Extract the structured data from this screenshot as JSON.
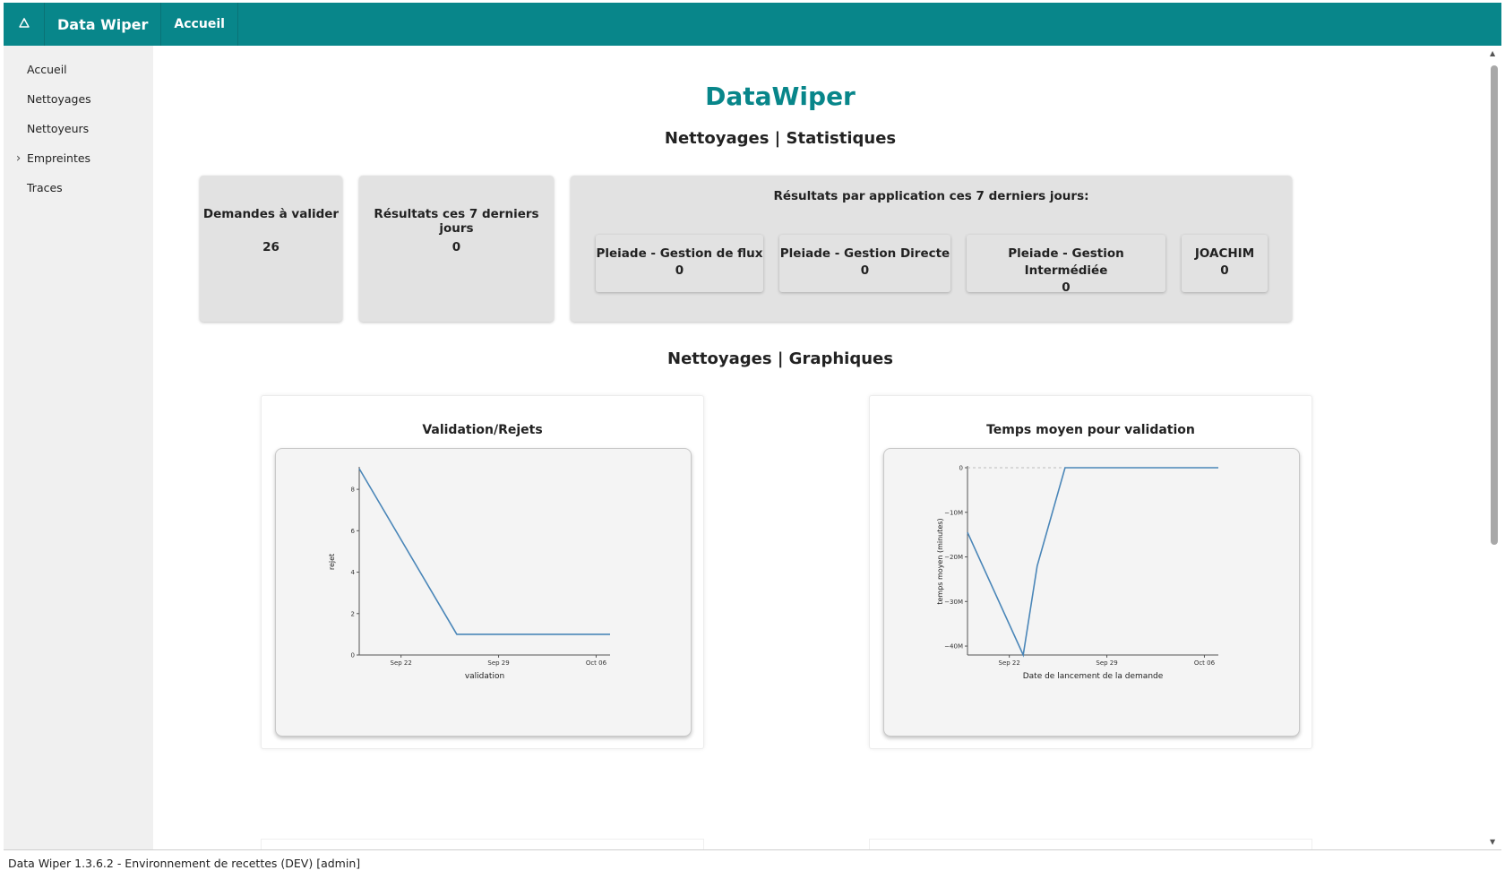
{
  "topbar": {
    "brand": "Data Wiper",
    "nav_home": "Accueil",
    "home_icon": "recycle-icon",
    "color": "#08868a"
  },
  "sidebar": {
    "items": [
      {
        "label": "Accueil"
      },
      {
        "label": "Nettoyages"
      },
      {
        "label": "Nettoyeurs"
      },
      {
        "label": "Empreintes",
        "expandable": true
      },
      {
        "label": "Traces"
      }
    ]
  },
  "main": {
    "title": "DataWiper",
    "stats_heading": "Nettoyages | Statistiques",
    "charts_heading": "Nettoyages | Graphiques",
    "stats": {
      "pending": {
        "label": "Demandes à valider",
        "value": "26"
      },
      "results7": {
        "label": "Résultats ces 7 derniers jours",
        "value": "0"
      },
      "by_app": {
        "label": "Résultats par application ces 7 derniers jours:",
        "apps": [
          {
            "name": "Pleiade - Gestion de flux",
            "value": "0"
          },
          {
            "name": "Pleiade - Gestion Directe",
            "value": "0"
          },
          {
            "name": "Pleiade - Gestion Intermédiée",
            "value": "0"
          },
          {
            "name": "JOACHIM",
            "value": "0"
          }
        ]
      }
    }
  },
  "chart_data": [
    {
      "type": "line",
      "title": "Validation/Rejets",
      "xlabel": "validation",
      "ylabel": "rejet",
      "x_ticks": [
        "Sep 22",
        "Sep 29",
        "Oct 06"
      ],
      "y_ticks": [
        "0",
        "2",
        "4",
        "6",
        "8"
      ],
      "ylim": [
        0,
        9
      ],
      "xlim": [
        "2020-09-19",
        "2020-10-07"
      ],
      "series": [
        {
          "x": [
            "2020-09-19",
            "2020-09-26",
            "2020-10-07"
          ],
          "values": [
            9,
            1,
            1
          ]
        }
      ],
      "line_color": "#4a86b8",
      "grid": false
    },
    {
      "type": "line",
      "title": "Temps moyen pour validation",
      "xlabel": "Date de lancement de la demande",
      "ylabel": "temps moyen (minutes)",
      "x_ticks": [
        "Sep 22",
        "Sep 29",
        "Oct 06"
      ],
      "y_ticks": [
        "−40M",
        "−30M",
        "−20M",
        "−10M",
        "0"
      ],
      "ylim": [
        -42000000,
        0
      ],
      "xlim": [
        "2020-09-19",
        "2020-10-07"
      ],
      "series": [
        {
          "x": [
            "2020-09-19",
            "2020-09-23",
            "2020-09-24",
            "2020-09-26",
            "2020-10-07"
          ],
          "values": [
            -14500000,
            -42000000,
            -22000000,
            0,
            0
          ]
        }
      ],
      "zero_line": "dashed",
      "line_color": "#4a86b8",
      "grid": false
    }
  ],
  "footer": {
    "text": "Data Wiper 1.3.6.2 - Environnement de recettes (DEV) [admin]"
  }
}
